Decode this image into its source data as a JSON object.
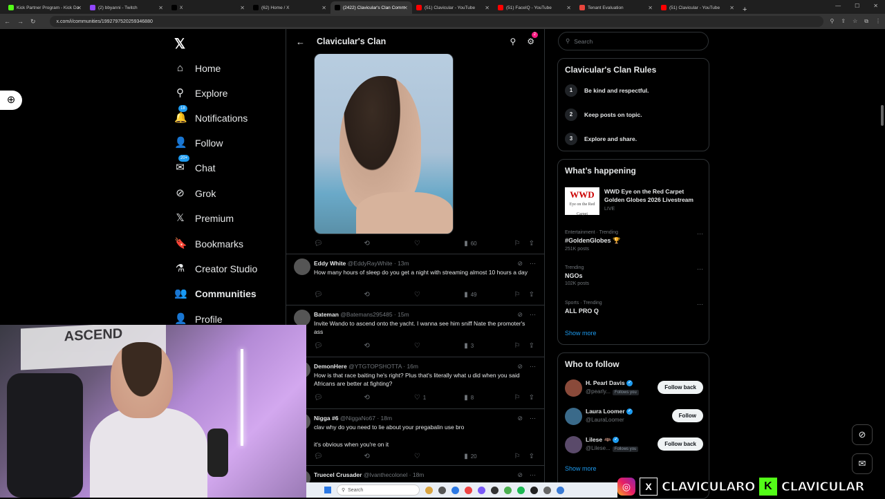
{
  "browser": {
    "tabs": [
      {
        "label": "Kick Partner Program - Kick Da",
        "color": "#53fc18"
      },
      {
        "label": "(2) bbyanni - Twitch",
        "color": "#9146ff"
      },
      {
        "label": "X",
        "color": "#000000"
      },
      {
        "label": "(62) Home / X",
        "color": "#000000"
      },
      {
        "label": "(2422) Clavicular's Clan Comm",
        "color": "#000000",
        "active": true
      },
      {
        "label": "(51) Clavicular - YouTube",
        "color": "#ff0000"
      },
      {
        "label": "(51) FaceIQ - YouTube",
        "color": "#ff0000"
      },
      {
        "label": "Tenant Evaluation",
        "color": "#e8453c"
      },
      {
        "label": "(51) Clavicular - YouTube",
        "color": "#ff0000"
      }
    ],
    "url": "x.com/i/communities/1992797520259346880"
  },
  "nav": {
    "items": [
      {
        "label": "Home",
        "icon": "home-icon",
        "glyph": "⌂"
      },
      {
        "label": "Explore",
        "icon": "search-icon",
        "glyph": "⚲"
      },
      {
        "label": "Notifications",
        "icon": "bell-icon",
        "glyph": "🔔",
        "badge": "18"
      },
      {
        "label": "Follow",
        "icon": "person-plus-icon",
        "glyph": "👤"
      },
      {
        "label": "Chat",
        "icon": "mail-icon",
        "glyph": "✉",
        "badge": "20+"
      },
      {
        "label": "Grok",
        "icon": "grok-icon",
        "glyph": "⊘"
      },
      {
        "label": "Premium",
        "icon": "x-logo-icon",
        "glyph": "𝕏"
      },
      {
        "label": "Bookmarks",
        "icon": "bookmark-icon",
        "glyph": "🔖"
      },
      {
        "label": "Creator Studio",
        "icon": "flask-icon",
        "glyph": "⚗"
      },
      {
        "label": "Communities",
        "icon": "communities-icon",
        "glyph": "👥",
        "bold": true
      },
      {
        "label": "Profile",
        "icon": "profile-icon",
        "glyph": "👤"
      }
    ]
  },
  "community": {
    "title": "Clavicular's Clan",
    "settings_badge": "2"
  },
  "first_post": {
    "views": "60"
  },
  "tweets": [
    {
      "name": "Eddy White",
      "handle": "@EddyRayWhite",
      "time": "· 13m",
      "text": "How many hours of sleep do you get a night with streaming almost 10 hours a day",
      "likes": "",
      "views": "49"
    },
    {
      "name": "Bateman",
      "handle": "@Batemans295485",
      "time": "· 15m",
      "text": "Invite Wando to ascend onto the yacht. I wanna see him sniff Nate the promoter's ass",
      "likes": "",
      "views": "3"
    },
    {
      "name": "DemonHere",
      "handle": "@YTGTOPSHOTTA",
      "time": "· 16m",
      "text": "How is that race baiting he's right? Plus that's literally what u did when you said Africans are better at fighting?",
      "likes": "1",
      "views": "8"
    },
    {
      "name": "Nigga #6",
      "handle": "@NiggaNo67",
      "time": "· 18m",
      "text": "clav why do you need to lie about your pregabalin use bro",
      "text2": "it's obvious when you're on it",
      "likes": "",
      "views": "20"
    },
    {
      "name": "Truecel Crusader",
      "handle": "@Ivanthecolonel",
      "time": "· 18m",
      "text": "",
      "likes": "",
      "views": ""
    }
  ],
  "sidebar": {
    "search_placeholder": "Search",
    "rules_title": "Clavicular's Clan Rules",
    "rules": [
      {
        "num": "1",
        "text": "Be kind and respectful."
      },
      {
        "num": "2",
        "text": "Keep posts on topic."
      },
      {
        "num": "3",
        "text": "Explore and share."
      }
    ],
    "happening_title": "What’s happening",
    "featured": {
      "logo_top": "WWD",
      "logo_bottom": "Eye on the Red Carpet",
      "title": "WWD Eye on the Red Carpet Golden Globes 2026 Livestream",
      "status": "LIVE"
    },
    "trends": [
      {
        "meta": "Entertainment · Trending",
        "title": "#GoldenGlobes 🏆",
        "count": "251K posts"
      },
      {
        "meta": "Trending",
        "title": "NGOs",
        "count": "102K posts"
      },
      {
        "meta": "Sports · Trending",
        "title": "ALL PRO Q",
        "count": ""
      }
    ],
    "show_more": "Show more",
    "who_title": "Who to follow",
    "who": [
      {
        "name": "H. Pearl Davis",
        "handle": "@pearly...",
        "follows_you": "Follows you",
        "button": "Follow back",
        "color": "#8a4a3a"
      },
      {
        "name": "Laura Loomer",
        "handle": "@LauraLoomer",
        "follows_you": "",
        "button": "Follow",
        "color": "#3a6a8a"
      },
      {
        "name": "Lilese 🦇",
        "handle": "@Lilese...",
        "follows_you": "Follows you",
        "button": "Follow back",
        "color": "#5a4a6a"
      }
    ],
    "who_show_more": "Show more"
  },
  "taskbar": {
    "search_placeholder": "Search"
  },
  "overlay": {
    "brand1": "CLAVICULARO",
    "brand2": "CLAVICULAR"
  },
  "webcam": {
    "banner_text": "ASCEND"
  }
}
